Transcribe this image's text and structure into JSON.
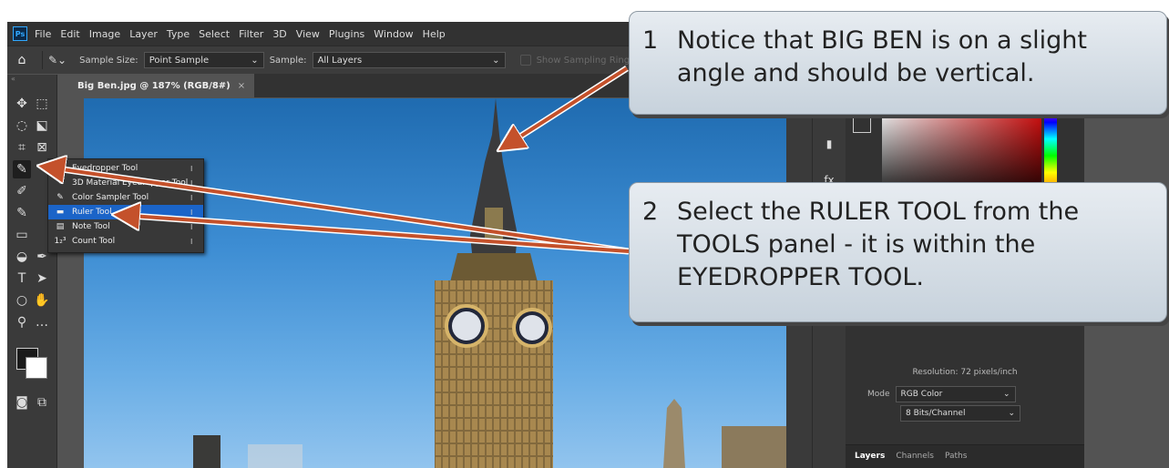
{
  "app": {
    "logo": "Ps"
  },
  "menu": [
    "File",
    "Edit",
    "Image",
    "Layer",
    "Type",
    "Select",
    "Filter",
    "3D",
    "View",
    "Plugins",
    "Window",
    "Help"
  ],
  "options": {
    "sample_size_label": "Sample Size:",
    "sample_size_value": "Point Sample",
    "sample_label": "Sample:",
    "sample_value": "All Layers",
    "show_ring": "Show Sampling Ring"
  },
  "document_tab": {
    "title": "Big Ben.jpg @ 187% (RGB/8#)",
    "close": "×"
  },
  "flyout": [
    {
      "icon": "eyedropper-icon",
      "glyph": "✎",
      "label": "Eyedropper Tool",
      "key": "I",
      "selected": false
    },
    {
      "icon": "3d-eyedropper-icon",
      "glyph": "✎",
      "label": "3D Material Eyedropper Tool",
      "key": "I",
      "selected": false
    },
    {
      "icon": "color-sampler-icon",
      "glyph": "✎",
      "label": "Color Sampler Tool",
      "key": "I",
      "selected": false
    },
    {
      "icon": "ruler-icon",
      "glyph": "▬",
      "label": "Ruler Tool",
      "key": "I",
      "selected": true
    },
    {
      "icon": "note-icon",
      "glyph": "▤",
      "label": "Note Tool",
      "key": "I",
      "selected": false
    },
    {
      "icon": "count-icon",
      "glyph": "1₂³",
      "label": "Count Tool",
      "key": "I",
      "selected": false
    }
  ],
  "properties": {
    "resolution": "Resolution: 72 pixels/inch",
    "mode_label": "Mode",
    "mode_value": "RGB Color",
    "bits_value": "8 Bits/Channel"
  },
  "layers_tabs": [
    "Layers",
    "Channels",
    "Paths"
  ],
  "callouts": [
    {
      "number": "1",
      "text": "Notice that BIG BEN is on a slight angle and should be vertical."
    },
    {
      "number": "2",
      "text": "Select the RULER TOOL from the TOOLS panel - it is within the EYEDROPPER TOOL."
    }
  ],
  "colors": {
    "arrow": "#c4512b",
    "callout_border": "#8e99a3",
    "selection": "#1b64c8"
  }
}
